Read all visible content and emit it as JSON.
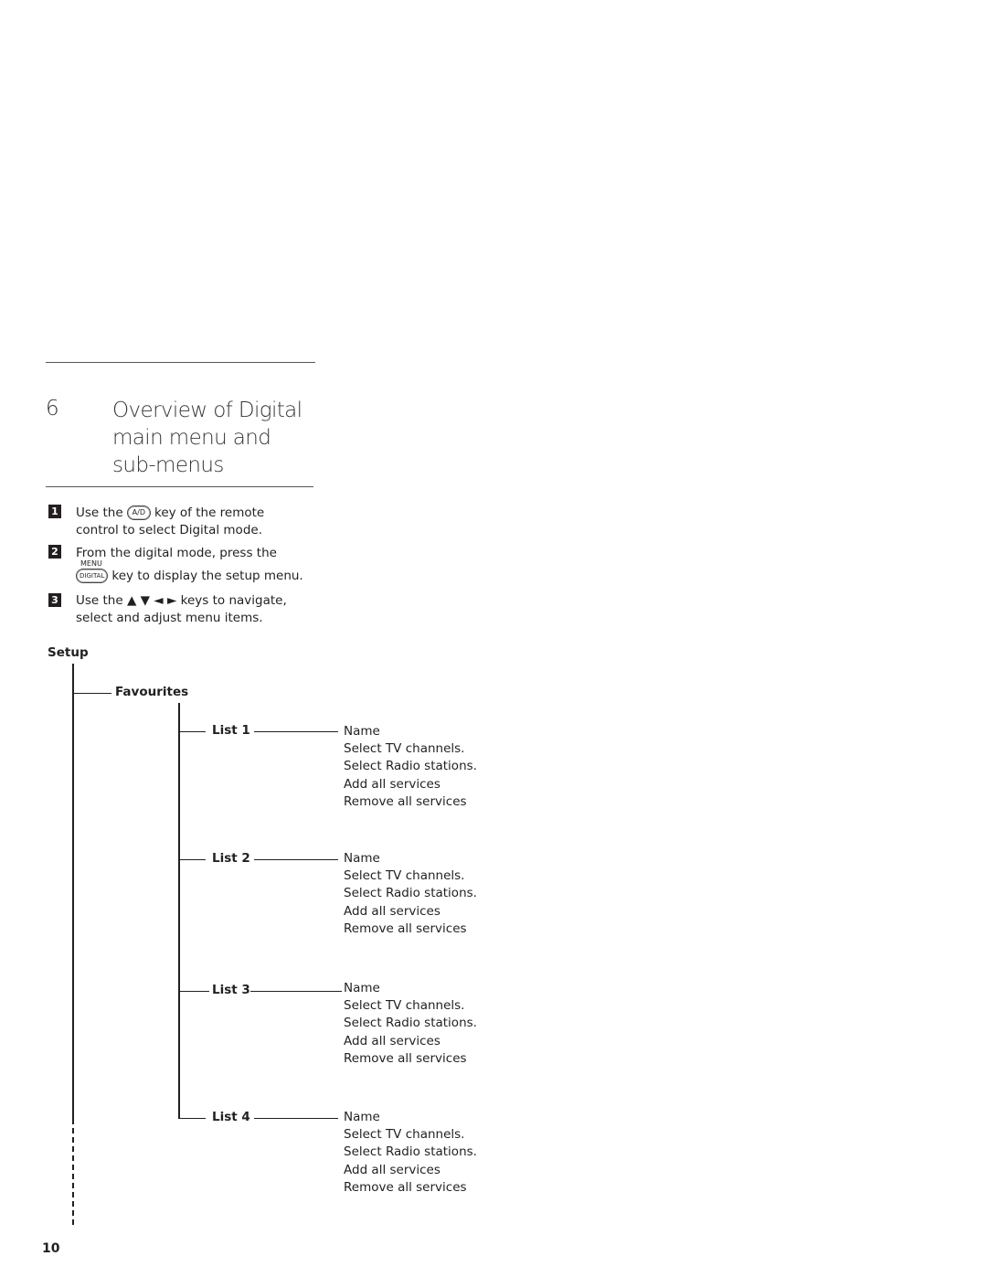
{
  "chapter": {
    "number": "6",
    "title_lines": [
      "Overview of Digital",
      "main menu and",
      "sub-menus"
    ]
  },
  "steps": [
    {
      "badge": "1",
      "text_before": "Use the",
      "key_label": "A/D",
      "text_after": "key of the remote",
      "line2": "control to select Digital mode."
    },
    {
      "badge": "2",
      "line1": "From the digital mode, press the",
      "key_sup": "MENU",
      "key_label": "DIGITAL",
      "text_after": "key to display the setup menu."
    },
    {
      "badge": "3",
      "line1": "Use the ▲ ▼ ◄  ► keys to navigate,",
      "line2": "select and adjust menu items."
    }
  ],
  "tree": {
    "root": "Setup",
    "child": "Favourites",
    "lists": [
      {
        "label": "List 1",
        "items": [
          "Name",
          "Select TV channels.",
          "Select Radio stations.",
          "Add all services",
          "Remove all services"
        ]
      },
      {
        "label": "List 2",
        "items": [
          "Name",
          "Select TV channels.",
          "Select Radio stations.",
          "Add all services",
          "Remove all services"
        ]
      },
      {
        "label": "List 3",
        "items": [
          "Name",
          "Select TV channels.",
          "Select Radio stations.",
          "Add all services",
          "Remove all services"
        ]
      },
      {
        "label": "List 4",
        "items": [
          "Name",
          "Select TV channels.",
          "Select Radio stations.",
          "Add all services",
          "Remove all services"
        ]
      }
    ]
  },
  "page_number": "10"
}
